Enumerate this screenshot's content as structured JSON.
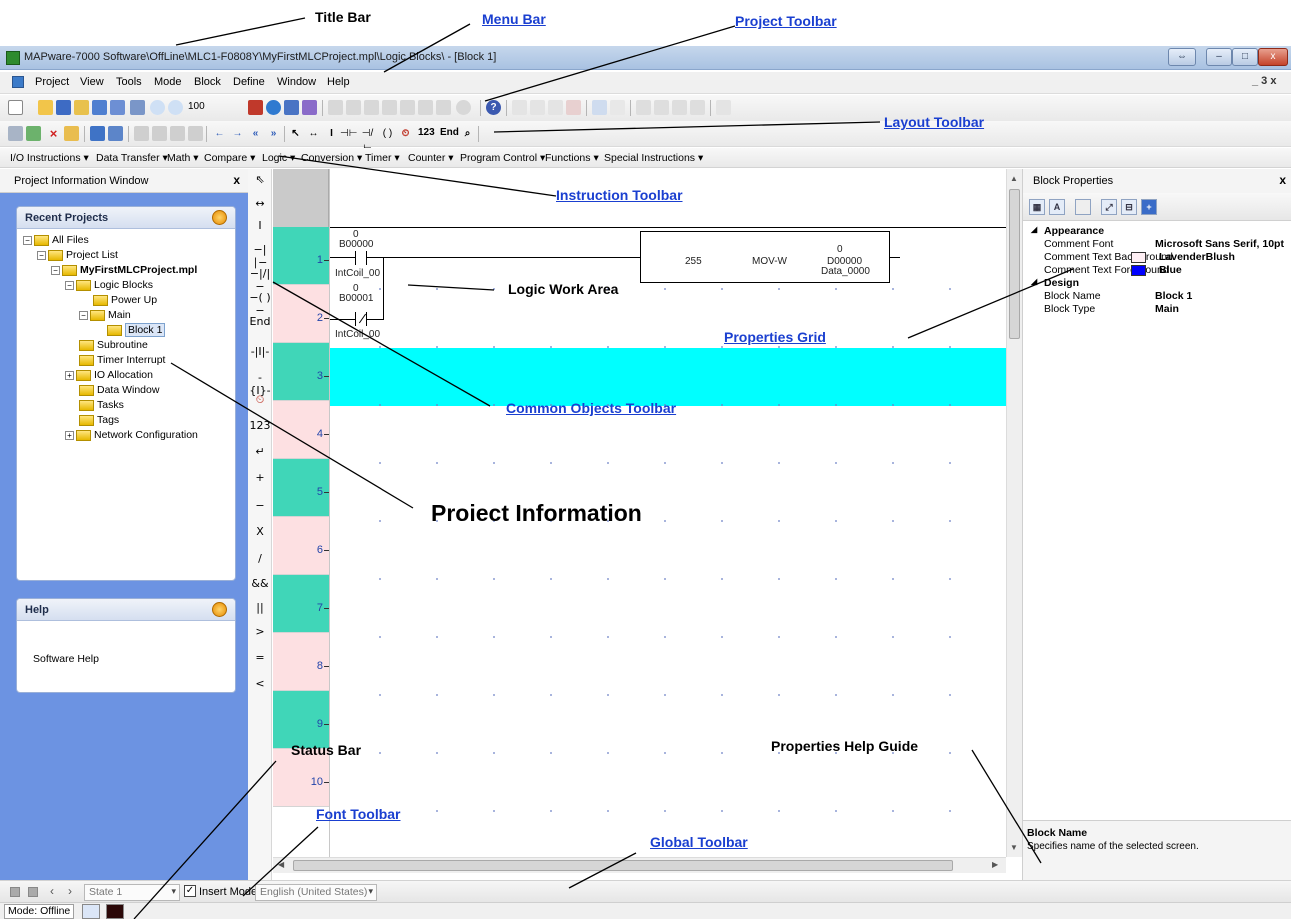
{
  "window": {
    "title": "MAPware-7000 Software\\OffLine\\MLC1-F0808Y\\MyFirstMLCProject.mpl\\Logic Blocks\\ - [Block 1]",
    "buttons": {
      "restore": "⇔",
      "minimize": "–",
      "maximize": "□",
      "close": "x"
    }
  },
  "menu": {
    "items": [
      "Project",
      "View",
      "Tools",
      "Mode",
      "Block",
      "Define",
      "Window",
      "Help"
    ],
    "mdi_controls": "_ 3 x"
  },
  "project_toolbar": {
    "zoom": "100"
  },
  "layout_toolbar": {
    "count_label": "123",
    "end_label": "End"
  },
  "instruction_toolbar": {
    "items": [
      "I/O Instructions ▾",
      "Data Transfer ▾",
      "Math ▾",
      "Compare ▾",
      "Logic ▾",
      "Conversion ▾",
      "Timer ▾",
      "Counter ▾",
      "Program Control ▾",
      "Functions ▾",
      "Special Instructions ▾"
    ]
  },
  "project_info": {
    "pane_title": "Project Information Window",
    "close": "x",
    "recent_title": "Recent Projects",
    "tree": [
      {
        "label": "All Files",
        "exp": "−",
        "bold": false,
        "sel": false
      },
      {
        "label": "Project List",
        "exp": "−",
        "bold": false,
        "sel": false
      },
      {
        "label": "MyFirstMLCProject.mpl",
        "exp": "−",
        "bold": true,
        "sel": false
      },
      {
        "label": "Logic Blocks",
        "exp": "−",
        "bold": false,
        "sel": false
      },
      {
        "label": "Power Up",
        "exp": "",
        "bold": false,
        "sel": false
      },
      {
        "label": "Main",
        "exp": "−",
        "bold": false,
        "sel": false
      },
      {
        "label": "Block 1",
        "exp": "",
        "bold": false,
        "sel": true
      },
      {
        "label": "Subroutine",
        "exp": "",
        "bold": false,
        "sel": false
      },
      {
        "label": "Timer Interrupt",
        "exp": "",
        "bold": false,
        "sel": false
      },
      {
        "label": "IO Allocation",
        "exp": "+",
        "bold": false,
        "sel": false
      },
      {
        "label": "Data Window",
        "exp": "",
        "bold": false,
        "sel": false
      },
      {
        "label": "Tasks",
        "exp": "",
        "bold": false,
        "sel": false
      },
      {
        "label": "Tags",
        "exp": "",
        "bold": false,
        "sel": false
      },
      {
        "label": "Network Configuration",
        "exp": "+",
        "bold": false,
        "sel": false
      }
    ],
    "help_title": "Help",
    "help_text": "Software Help"
  },
  "common_objects": [
    "⇖",
    "↔",
    "I",
    "−|∣−",
    "−|/|−",
    "−( )−",
    "End",
    "-|I|-",
    "-{I}-",
    "⏲",
    "123",
    "↵",
    "+",
    "−",
    "X",
    "/",
    "&&",
    "||",
    ">",
    "=",
    "<"
  ],
  "ladder": {
    "rungs": [
      "1",
      "2",
      "3",
      "4",
      "5",
      "6",
      "7",
      "8",
      "9",
      "10"
    ],
    "contact1": {
      "value": "0",
      "address": "B00000",
      "tag": "IntCoil_00"
    },
    "contact2": {
      "value": "0",
      "address": "B00001",
      "tag": "IntCoil_00"
    },
    "move": {
      "source": "255",
      "name": "MOV-W",
      "dest_value": "0",
      "dest_address": "D00000",
      "dest_tag": "Data_0000"
    }
  },
  "properties": {
    "title": "Block Properties",
    "close": "x",
    "categories": [
      {
        "name": "Appearance",
        "rows": [
          {
            "key": "Comment Font",
            "value": "Microsoft Sans Serif, 10pt",
            "swatch": ""
          },
          {
            "key": "Comment Text BackGround",
            "value": "LavenderBlush",
            "swatch": "#fff0f5"
          },
          {
            "key": "Comment Text Foreground",
            "value": "Blue",
            "swatch": "#0000ff"
          }
        ]
      },
      {
        "name": "Design",
        "rows": [
          {
            "key": "Block Name",
            "value": "Block 1",
            "swatch": ""
          },
          {
            "key": "Block Type",
            "value": "Main",
            "swatch": ""
          }
        ]
      }
    ],
    "help_title": "Block Name",
    "help_desc": "Specifies name of the selected screen."
  },
  "global_toolbar": {
    "state": "State 1",
    "insert_mode": "Insert Mode",
    "insert_checked": "✓",
    "language": "English (United States)"
  },
  "status": {
    "mode": "Mode: Offline"
  },
  "annotations": {
    "title_bar": "Title Bar",
    "menu_bar": "Menu Bar",
    "project_toolbar": "Project Toolbar",
    "layout_toolbar": "Layout Toolbar",
    "instruction_toolbar": "Instruction Toolbar",
    "logic_work_area": "Logic Work Area",
    "properties_grid": "Properties Grid",
    "common_objects_toolbar": "Common Objects Toolbar",
    "project_information": "Proiect Information",
    "status_bar": "Status Bar",
    "properties_help_guide": "Properties Help Guide",
    "font_toolbar": "Font Toolbar",
    "global_toolbar": "Global Toolbar"
  },
  "colors": {
    "rung_teal": "#40d6b8",
    "rung_pink": "#fde0e2",
    "highlight": "#00ffff",
    "left_pane_bg": "#6c93e2"
  }
}
